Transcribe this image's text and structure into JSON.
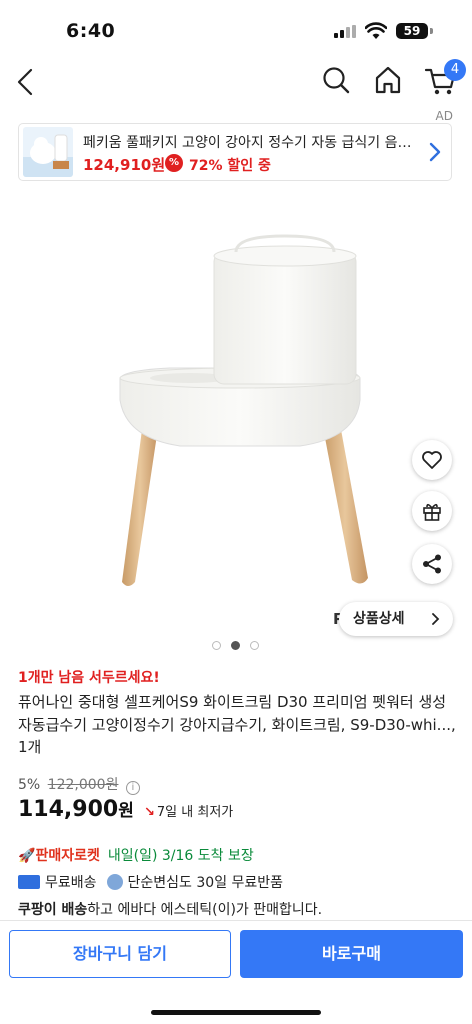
{
  "status_bar": {
    "time": "6:40",
    "battery": "59",
    "icons": [
      "signal-icon",
      "wifi-icon",
      "battery-icon"
    ]
  },
  "nav": {
    "icons": [
      "back-icon",
      "search-icon",
      "home-icon",
      "cart-icon"
    ],
    "cart_badge": "4"
  },
  "ad": {
    "label": "AD",
    "title": "페키움 풀패키지 고양이 강아지 정수기 자동 급식기 음수대 세트",
    "price": "124,910원",
    "discount_icon": "%",
    "discount": "72% 할인 중"
  },
  "product_image": {
    "brand_watermark": "PUR",
    "detail_button": "상품상세",
    "fab_icons": [
      "heart-icon",
      "gift-icon",
      "share-icon"
    ],
    "pagination": {
      "count": 3,
      "active_index": 1
    }
  },
  "product": {
    "urgent": "1개만 남음 서두르세요!",
    "title": "퓨어나인 중대형 셀프케어S9 화이트크림 D30 프리미엄 펫워터 생성 자동급수기 고양이정수기 강아지급수기, 화이트크림, S9-D30-whi..., 1개",
    "discount_rate": "5%",
    "original_price": "122,000원",
    "info_icon": "i",
    "sale_price": "114,900",
    "price_unit": "원",
    "lowest_badge": "7일 내 최저가",
    "rocket_label": "판매자로켓",
    "delivery": "내일(일) 3/16 도착 보장",
    "free_shipping": "무료배송",
    "free_return": "단순변심도 30일 무료반품",
    "seller_prefix": "쿠팡이 배송",
    "seller_suffix": "하고 에바다 에스테틱(이)가 판매합니다."
  },
  "bottom_bar": {
    "cart_label": "장바구니 담기",
    "buy_label": "바로구매"
  },
  "colors": {
    "accent_blue": "#3478f6",
    "sale_red": "#e02020",
    "delivery_green": "#0a8a3a"
  }
}
